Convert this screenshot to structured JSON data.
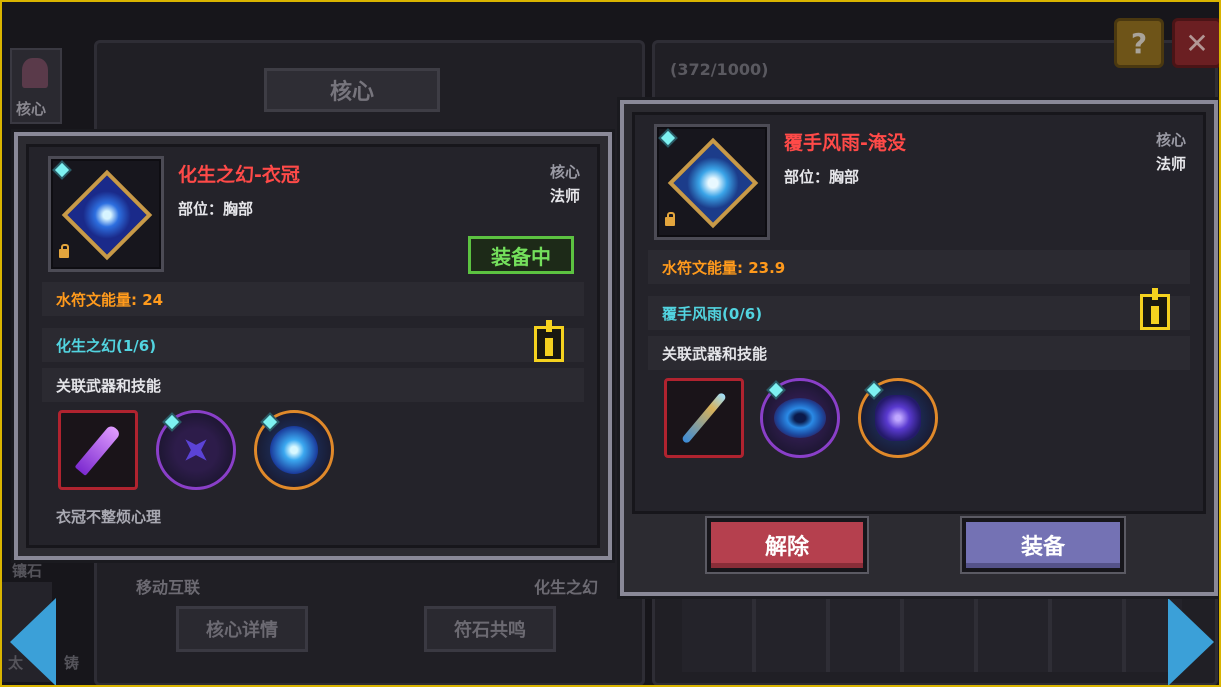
{
  "background": {
    "header_tab": "核心",
    "sidebar_label": "核心",
    "counter": "(372/1000)",
    "side_label_2": "镶石",
    "side_label_3": "太",
    "side_label_4": "铸",
    "bottom_left_label": "移动互联",
    "bottom_right_label": "化生之幻",
    "core_details_button": "核心详情",
    "rune_resonance_button": "符石共鸣"
  },
  "top_buttons": {
    "help_label": "?",
    "close_label": "✕"
  },
  "left_item": {
    "name": "化生之幻-衣冠",
    "slot_label": "部位：胸部",
    "type": "核心",
    "class": "法师",
    "equipped_badge": "装备中",
    "energy_label": "水符文能量: 24",
    "set_label": "化生之幻(1/6)",
    "linked_label": "关联武器和技能",
    "flavor_text": "衣冠不整烦心理",
    "linked_icons": [
      "purple-sword-icon",
      "purple-shuriken-icon",
      "blue-orb-icon"
    ]
  },
  "right_item": {
    "name": "覆手风雨-淹没",
    "slot_label": "部位：胸部",
    "type": "核心",
    "class": "法师",
    "energy_label": "水符文能量: 23.9",
    "set_label": "覆手风雨(0/6)",
    "linked_label": "关联武器和技能",
    "linked_icons": [
      "ice-staff-icon",
      "whirlpool-icon",
      "dark-crystal-icon"
    ]
  },
  "actions": {
    "unequip_label": "解除",
    "equip_label": "装备"
  },
  "colors": {
    "item_name": "#ff4a48",
    "energy": "#ff9a1c",
    "set_bonus": "#52d4e0",
    "equipped": "#74e05c",
    "frame": "#d9b400"
  }
}
